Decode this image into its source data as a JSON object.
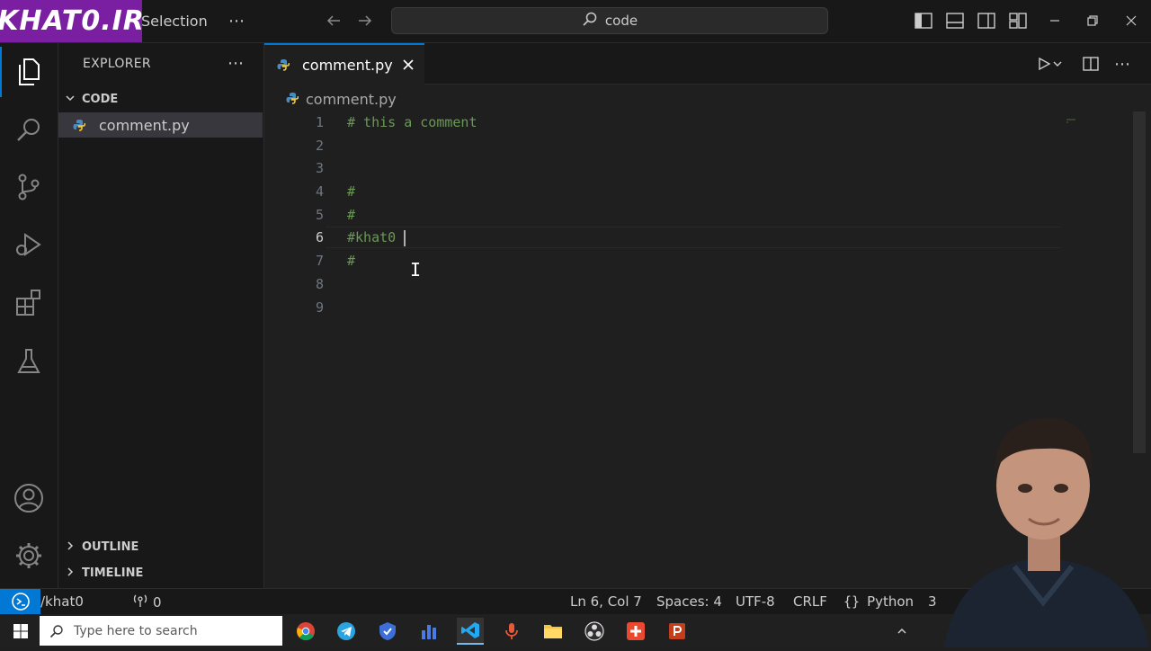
{
  "brand": {
    "logo_text": "KHAT0.IR"
  },
  "titlebar": {
    "menu_label": "Selection",
    "search_text": "code"
  },
  "sidebar": {
    "title": "EXPLORER",
    "folder": "CODE",
    "files": [
      "comment.py"
    ],
    "outline_label": "OUTLINE",
    "timeline_label": "TIMELINE"
  },
  "editor": {
    "tab_label": "comment.py",
    "breadcrumb": "comment.py",
    "current_line": 6,
    "lines": [
      {
        "n": "1",
        "text": "# this a comment"
      },
      {
        "n": "2",
        "text": ""
      },
      {
        "n": "3",
        "text": ""
      },
      {
        "n": "4",
        "text": "#"
      },
      {
        "n": "5",
        "text": "#"
      },
      {
        "n": "6",
        "text": "#khat0"
      },
      {
        "n": "7",
        "text": "#"
      },
      {
        "n": "8",
        "text": ""
      },
      {
        "n": "9",
        "text": ""
      }
    ]
  },
  "statusbar": {
    "left_text": "/khat0",
    "errors": "0",
    "ports": "0",
    "position": "Ln 6, Col 7",
    "spaces": "Spaces: 4",
    "encoding": "UTF-8",
    "eol": "CRLF",
    "language": "Python",
    "extra": "3"
  },
  "taskbar": {
    "search_placeholder": "Type here to search"
  },
  "colors": {
    "accent": "#0078d4",
    "comment": "#6a9955",
    "brand": "#7b1fa2",
    "background": "#1f1f1f"
  }
}
